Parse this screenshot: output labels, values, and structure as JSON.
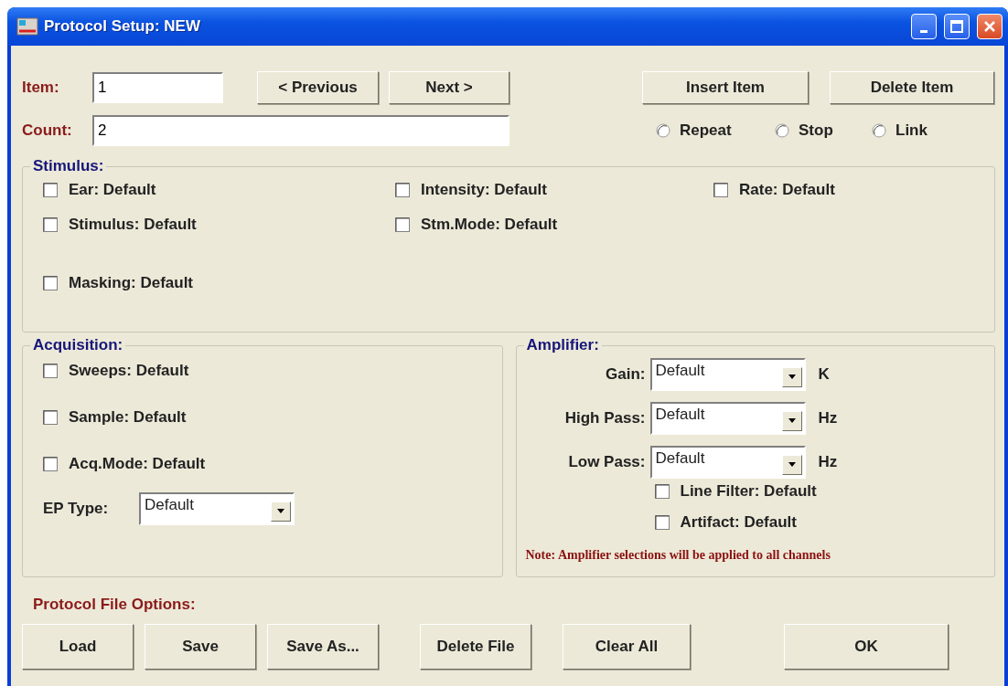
{
  "window": {
    "title": "Protocol Setup: NEW"
  },
  "item": {
    "label": "Item:",
    "value": "1"
  },
  "count": {
    "label": "Count:",
    "value": "2"
  },
  "nav_buttons": [
    "< Previous",
    "Next >"
  ],
  "item_buttons": [
    "Insert Item",
    "Delete Item"
  ],
  "modes": [
    {
      "label": "Repeat",
      "selected": false
    },
    {
      "label": "Stop",
      "selected": false
    },
    {
      "label": "Link",
      "selected": false
    }
  ],
  "stimulus": {
    "legend": "Stimulus:",
    "rows": [
      [
        {
          "label": "Ear: Default",
          "checked": false
        },
        {
          "label": "Intensity: Default",
          "checked": false
        },
        {
          "label": "Rate: Default",
          "checked": false
        }
      ],
      [
        {
          "label": "Stimulus: Default",
          "checked": false
        },
        {
          "label": "Stm.Mode: Default",
          "checked": false
        }
      ],
      [
        {
          "label": "Masking: Default",
          "checked": false
        }
      ]
    ]
  },
  "acquisition": {
    "legend": "Acquisition:",
    "options": [
      {
        "label": "Sweeps: Default",
        "checked": false
      },
      {
        "label": "Sample: Default",
        "checked": false
      },
      {
        "label": "Acq.Mode: Default",
        "checked": false
      }
    ],
    "ep_type": {
      "label": "EP Type:",
      "value": "Default"
    }
  },
  "amplifier": {
    "legend": "Amplifier:",
    "selects": [
      {
        "label": "Gain:",
        "value": "Default",
        "unit": "K"
      },
      {
        "label": "High Pass:",
        "value": "Default",
        "unit": "Hz"
      },
      {
        "label": "Low Pass:",
        "value": "Default",
        "unit": "Hz"
      }
    ],
    "options": [
      {
        "label": "Line Filter: Default",
        "checked": false
      },
      {
        "label": "Artifact: Default",
        "checked": false
      }
    ],
    "note": "Note: Amplifier selections will be applied to all channels"
  },
  "file_options": {
    "label": "Protocol File Options:",
    "buttons": [
      "Load",
      "Save",
      "Save As...",
      "Delete File",
      "Clear All"
    ]
  },
  "ok_button": "OK"
}
